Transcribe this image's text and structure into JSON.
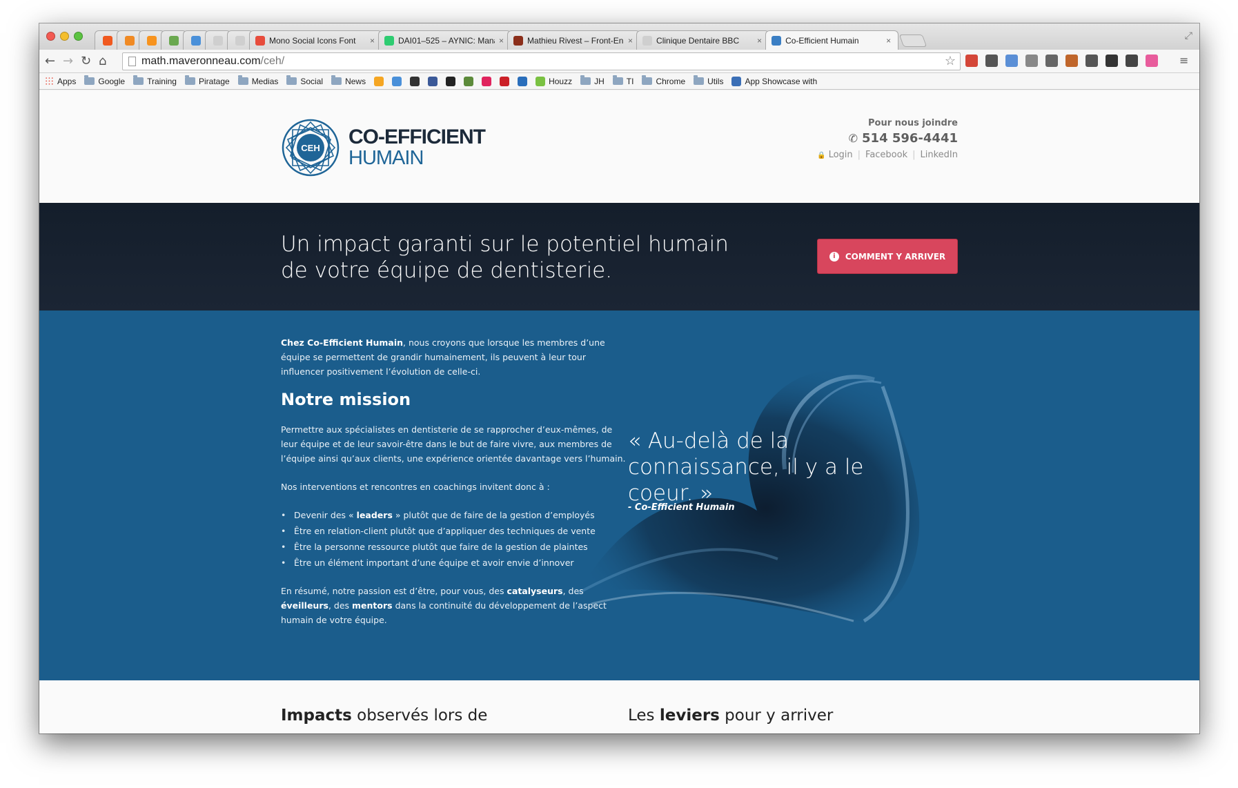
{
  "browser": {
    "tabs": [
      {
        "title": "",
        "pinned": true,
        "color": "#f0591f"
      },
      {
        "title": "",
        "pinned": true,
        "color": "#f08a24"
      },
      {
        "title": "",
        "pinned": true,
        "color": "#f7931e"
      },
      {
        "title": "",
        "pinned": true,
        "color": "#6aa84f"
      },
      {
        "title": "",
        "pinned": true,
        "color": "#4a90d9"
      },
      {
        "title": "",
        "pinned": true,
        "color": "#cfcfcf"
      },
      {
        "title": "",
        "pinned": true,
        "color": "#cfcfcf"
      },
      {
        "title": "Mono Social Icons Font",
        "pinned": false,
        "color": "#e74c3c"
      },
      {
        "title": "DAI01–525 – AYNIC: Mana",
        "pinned": false,
        "color": "#2ecc71"
      },
      {
        "title": "Mathieu Rivest – Front-En",
        "pinned": false,
        "color": "#8b2e1a"
      },
      {
        "title": "Clinique Dentaire BBC",
        "pinned": false,
        "color": "#cfcfcf"
      },
      {
        "title": "Co-Efficient Humain",
        "pinned": false,
        "color": "#3b7fc4",
        "active": true
      }
    ],
    "url_domain": "math.maveronneau.com",
    "url_path": "/ceh/",
    "bookmarks": [
      {
        "label": "Apps",
        "type": "apps"
      },
      {
        "label": "Google",
        "type": "folder"
      },
      {
        "label": "Training",
        "type": "folder"
      },
      {
        "label": "Piratage",
        "type": "folder"
      },
      {
        "label": "Medias",
        "type": "folder"
      },
      {
        "label": "Social",
        "type": "folder"
      },
      {
        "label": "News",
        "type": "folder"
      },
      {
        "label": "",
        "type": "icon",
        "color": "#f5a623"
      },
      {
        "label": "",
        "type": "icon",
        "color": "#4a90d9"
      },
      {
        "label": "",
        "type": "icon",
        "color": "#333333"
      },
      {
        "label": "",
        "type": "icon",
        "color": "#3b5998"
      },
      {
        "label": "",
        "type": "icon",
        "color": "#222222"
      },
      {
        "label": "",
        "type": "icon",
        "color": "#5c8a3a"
      },
      {
        "label": "",
        "type": "icon",
        "color": "#e0245e"
      },
      {
        "label": "",
        "type": "icon",
        "color": "#cb2027"
      },
      {
        "label": "",
        "type": "icon",
        "color": "#2a6ebb"
      },
      {
        "label": "Houzz",
        "type": "icon",
        "color": "#7ac142"
      },
      {
        "label": "JH",
        "type": "folder"
      },
      {
        "label": "TI",
        "type": "folder"
      },
      {
        "label": "Chrome",
        "type": "folder"
      },
      {
        "label": "Utils",
        "type": "folder"
      },
      {
        "label": "App Showcase with",
        "type": "icon",
        "color": "#3b6fb6"
      }
    ],
    "extensions": [
      "#d44638",
      "#555555",
      "#5b8fd6",
      "#888888",
      "#666666",
      "#c0662b",
      "#555555",
      "#333333",
      "#444444",
      "#e85c9c"
    ]
  },
  "site": {
    "logo_badge": "CEH",
    "logo_line1": "CO-EFFICIENT",
    "logo_line2": "HUMAIN",
    "contact_label": "Pour nous joindre",
    "phone": "514 596-4441",
    "links": {
      "login": "Login",
      "facebook": "Facebook",
      "linkedin": "LinkedIn"
    },
    "hero": {
      "text": "Un impact garanti sur le potentiel humain de votre équipe de dentisterie.",
      "button": "COMMENT Y ARRIVER"
    },
    "intro_bold": "Chez Co-Efficient Humain",
    "intro_rest": ", nous croyons que lorsque les membres d’une équipe se permettent de grandir humainement, ils peuvent à leur tour influencer positivement l’évolution de celle-ci.",
    "mission_title": "Notre mission",
    "mission_p1": "Permettre aux spécialistes en dentisterie de se rapprocher d’eux-mêmes, de leur équipe et de leur savoir-être dans le but de faire vivre, aux membres de l’équipe ainsi qu’aux clients, une expérience orientée davantage vers l’humain.",
    "mission_p2": "Nos interventions et rencontres en coachings invitent donc à :",
    "bullet1_pre": "Devenir des « ",
    "bullet1_bold": "leaders",
    "bullet1_post": " » plutôt que de faire de la gestion d’employés",
    "bullet2": "Être en relation-client plutôt que d’appliquer des techniques de vente",
    "bullet3": "Être la personne ressource plutôt que faire de la gestion de plaintes",
    "bullet4": "Être un élément important d’une équipe et avoir envie d’innover",
    "summary_1": "En résumé, notre passion est d’être, pour vous, des ",
    "summary_b1": "catalyseurs",
    "summary_2": ", des ",
    "summary_b2": "éveilleurs",
    "summary_3": ", des ",
    "summary_b3": "mentors",
    "summary_4": " dans la continuité du développement de l’aspect humain de votre équipe.",
    "quote": "« Au-delà de la connaissance, il y a le coeur. »",
    "quote_author": "- Co-Efficient Humain",
    "bottom_left_bold": "Impacts",
    "bottom_left_rest": " observés lors de",
    "bottom_right_pre": "Les ",
    "bottom_right_bold": "leviers",
    "bottom_right_rest": " pour y arriver"
  }
}
